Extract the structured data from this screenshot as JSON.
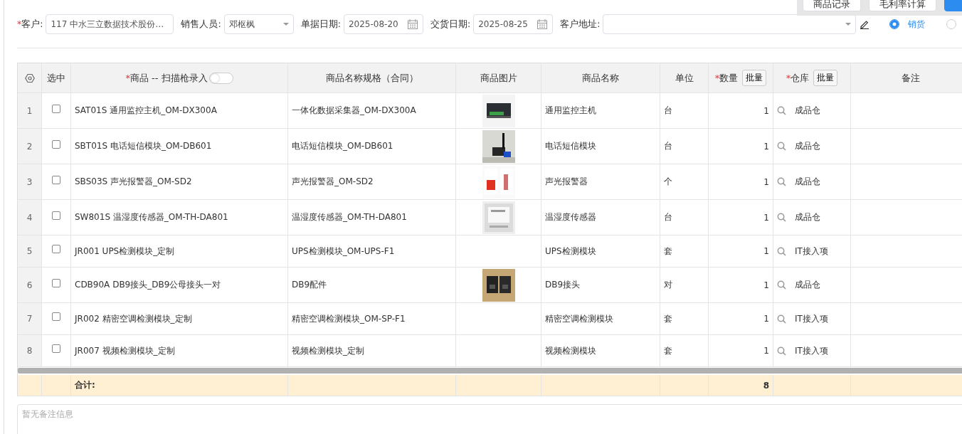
{
  "toolbar": {
    "buttons": [
      {
        "label": "商品记录",
        "kind": "default"
      },
      {
        "label": "毛利率计算",
        "kind": "default"
      },
      {
        "kind": "primary"
      }
    ]
  },
  "form": {
    "fields": [
      {
        "kind": "text",
        "mark": "*",
        "label": "客户:",
        "value": "117 中水三立数据技术股份…"
      },
      {
        "kind": "select",
        "label": "销售人员:",
        "value": "邓枢枫"
      },
      {
        "kind": "date",
        "label": "单据日期:",
        "value": "2025-08-20"
      },
      {
        "kind": "date",
        "label": "交货日期:",
        "value": "2025-08-25"
      },
      {
        "kind": "address",
        "label": "客户地址:"
      }
    ],
    "type_options": [
      {
        "label": "销货",
        "selected": true
      },
      {
        "selected": false
      }
    ]
  },
  "table": {
    "columns": [
      {
        "kind": "settings"
      },
      {
        "kind": "text",
        "label": "选中"
      },
      {
        "kind": "toggle",
        "mark": "*",
        "label": "商品 -- 扫描枪录入",
        "on": false
      },
      {
        "kind": "text",
        "label": "商品名称规格（合同）"
      },
      {
        "kind": "text",
        "label": "商品图片"
      },
      {
        "kind": "text",
        "label": "商品名称"
      },
      {
        "kind": "text",
        "label": "单位"
      },
      {
        "kind": "batch",
        "mark": "*",
        "label": "数量",
        "button": "批量"
      },
      {
        "kind": "batch",
        "mark": "*",
        "label": "仓库",
        "button": "批量"
      },
      {
        "kind": "text",
        "label": "备注"
      }
    ],
    "rows": [
      {
        "index": "1",
        "checked": false,
        "product": "SAT01S 通用监控主机_OM-DX300A",
        "spec": "一体化数据采集器_OM-DX300A",
        "picture": true,
        "name": "通用监控主机",
        "unit": "台",
        "qty": "1",
        "warehouse": "成品仓"
      },
      {
        "index": "2",
        "checked": false,
        "product": "SBT01S 电话短信模块_OM-DB601",
        "spec": "电话短信模块_OM-DB601",
        "picture": true,
        "name": "电话短信模块",
        "unit": "台",
        "qty": "1",
        "warehouse": "成品仓"
      },
      {
        "index": "3",
        "checked": false,
        "product": "SBS03S 声光报警器_OM-SD2",
        "spec": "声光报警器_OM-SD2",
        "picture": true,
        "name": "声光报警器",
        "unit": "个",
        "qty": "1",
        "warehouse": "成品仓"
      },
      {
        "index": "4",
        "checked": false,
        "product": "SW801S 温湿度传感器_OM-TH-DA801",
        "spec": "温湿度传感器_OM-TH-DA801",
        "picture": true,
        "name": "温湿度传感器",
        "unit": "台",
        "qty": "1",
        "warehouse": "成品仓"
      },
      {
        "index": "5",
        "checked": false,
        "product": "JR001 UPS检测模块_定制",
        "spec": "UPS检测模块_OM-UPS-F1",
        "picture": false,
        "name": "UPS检测模块",
        "unit": "套",
        "qty": "1",
        "warehouse": "IT接入项"
      },
      {
        "index": "6",
        "checked": false,
        "product": "CDB90A DB9接头_DB9公母接头一对",
        "spec": "DB9配件",
        "picture": true,
        "name": "DB9接头",
        "unit": "对",
        "qty": "1",
        "warehouse": "成品仓"
      },
      {
        "index": "7",
        "checked": false,
        "product": "JR002 精密空调检测模块_定制",
        "spec": "精密空调检测模块_OM-SP-F1",
        "picture": false,
        "name": "精密空调检测模块",
        "unit": "套",
        "qty": "1",
        "warehouse": "IT接入项"
      },
      {
        "index": "8",
        "checked": false,
        "product": "JR007 视频检测模块_定制",
        "spec": "视频检测模块_定制",
        "picture": false,
        "name": "视频检测模块",
        "unit": "套",
        "qty": "1",
        "warehouse": "IT接入项"
      }
    ],
    "total": {
      "label": "合计:",
      "qty": "8"
    }
  },
  "remarks": {
    "placeholder": "暂无备注信息"
  }
}
